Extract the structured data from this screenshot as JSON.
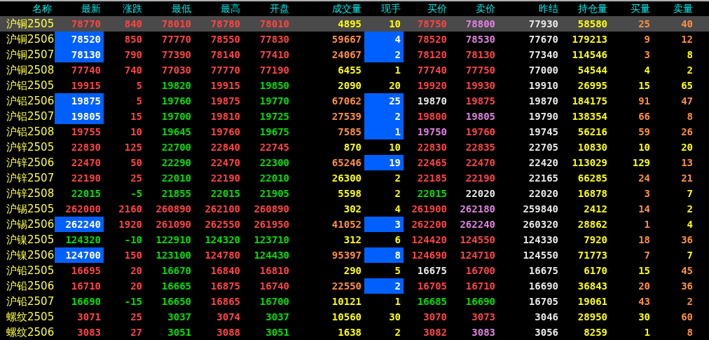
{
  "columns": [
    "名称",
    "最新",
    "涨跌",
    "最低",
    "最高",
    "开盘",
    "成交量",
    "现手",
    "买价",
    "卖价",
    "昨结",
    "持仓量",
    "买量",
    "卖量"
  ],
  "rows": [
    {
      "name": "沪铜2505",
      "selected": true,
      "last_flash": false,
      "hand_flash": false,
      "cells": [
        {
          "t": "78770",
          "color": "#ff4444"
        },
        {
          "t": "840",
          "color": "#ff4444"
        },
        {
          "t": "78010",
          "color": "#ff4444"
        },
        {
          "t": "78780",
          "color": "#ff4444"
        },
        {
          "t": "78010",
          "color": "#ff4444"
        },
        {
          "t": "4895",
          "color": "#ffff00"
        },
        {
          "t": "10",
          "color": "#ffff00"
        },
        {
          "t": "78750",
          "color": "#ff4444"
        },
        {
          "t": "78800",
          "color": "#e080e0"
        },
        {
          "t": "77930",
          "color": "#e8e8e8"
        },
        {
          "t": "58580",
          "color": "#ffff00"
        },
        {
          "t": "25",
          "color": "#ff9040"
        },
        {
          "t": "40",
          "color": "#ff9040"
        }
      ]
    },
    {
      "name": "沪铜2506",
      "selected": false,
      "last_flash": true,
      "hand_flash": true,
      "cells": [
        {
          "t": "78520",
          "color": "#ffffff"
        },
        {
          "t": "850",
          "color": "#ff4444"
        },
        {
          "t": "77770",
          "color": "#ff4444"
        },
        {
          "t": "78550",
          "color": "#ff4444"
        },
        {
          "t": "77830",
          "color": "#ff4444"
        },
        {
          "t": "59667",
          "color": "#ff9040"
        },
        {
          "t": "4",
          "color": "#ffffff"
        },
        {
          "t": "78520",
          "color": "#ff4444"
        },
        {
          "t": "78530",
          "color": "#e080e0"
        },
        {
          "t": "77670",
          "color": "#e8e8e8"
        },
        {
          "t": "179213",
          "color": "#ffff00"
        },
        {
          "t": "9",
          "color": "#ff9040"
        },
        {
          "t": "12",
          "color": "#ff9040"
        }
      ]
    },
    {
      "name": "沪铜2507",
      "selected": false,
      "last_flash": true,
      "hand_flash": true,
      "cells": [
        {
          "t": "78130",
          "color": "#ffffff"
        },
        {
          "t": "790",
          "color": "#ff4444"
        },
        {
          "t": "77390",
          "color": "#ff4444"
        },
        {
          "t": "78140",
          "color": "#ff4444"
        },
        {
          "t": "77410",
          "color": "#ff4444"
        },
        {
          "t": "24067",
          "color": "#ff9040"
        },
        {
          "t": "2",
          "color": "#ffffff"
        },
        {
          "t": "78120",
          "color": "#ff4444"
        },
        {
          "t": "78130",
          "color": "#ff4444"
        },
        {
          "t": "77340",
          "color": "#e8e8e8"
        },
        {
          "t": "114546",
          "color": "#ffff00"
        },
        {
          "t": "3",
          "color": "#ff9040"
        },
        {
          "t": "8",
          "color": "#ffff00"
        }
      ]
    },
    {
      "name": "沪铜2508",
      "selected": false,
      "last_flash": false,
      "hand_flash": false,
      "cells": [
        {
          "t": "77740",
          "color": "#ff4444"
        },
        {
          "t": "740",
          "color": "#ff4444"
        },
        {
          "t": "77030",
          "color": "#ff4444"
        },
        {
          "t": "77770",
          "color": "#ff4444"
        },
        {
          "t": "77190",
          "color": "#ff4444"
        },
        {
          "t": "6455",
          "color": "#ffff00"
        },
        {
          "t": "1",
          "color": "#ffff00"
        },
        {
          "t": "77740",
          "color": "#ff4444"
        },
        {
          "t": "77750",
          "color": "#ff4444"
        },
        {
          "t": "77000",
          "color": "#e8e8e8"
        },
        {
          "t": "54544",
          "color": "#ffff00"
        },
        {
          "t": "4",
          "color": "#ffff00"
        },
        {
          "t": "2",
          "color": "#ffff00"
        }
      ]
    },
    {
      "name": "沪铝2505",
      "selected": false,
      "last_flash": false,
      "hand_flash": false,
      "cells": [
        {
          "t": "19915",
          "color": "#ff4444"
        },
        {
          "t": "5",
          "color": "#ff4444"
        },
        {
          "t": "19820",
          "color": "#00e000"
        },
        {
          "t": "19915",
          "color": "#ff4444"
        },
        {
          "t": "19850",
          "color": "#00e000"
        },
        {
          "t": "2090",
          "color": "#ffff00"
        },
        {
          "t": "20",
          "color": "#ffff00"
        },
        {
          "t": "19920",
          "color": "#ff4444"
        },
        {
          "t": "19930",
          "color": "#ff4444"
        },
        {
          "t": "19910",
          "color": "#e8e8e8"
        },
        {
          "t": "26995",
          "color": "#ffff00"
        },
        {
          "t": "15",
          "color": "#ffff00"
        },
        {
          "t": "65",
          "color": "#ffff00"
        }
      ]
    },
    {
      "name": "沪铝2506",
      "selected": false,
      "last_flash": true,
      "hand_flash": true,
      "cells": [
        {
          "t": "19875",
          "color": "#ffffff"
        },
        {
          "t": "5",
          "color": "#ff4444"
        },
        {
          "t": "19760",
          "color": "#00e000"
        },
        {
          "t": "19875",
          "color": "#ff4444"
        },
        {
          "t": "19770",
          "color": "#00e000"
        },
        {
          "t": "67062",
          "color": "#ff9040"
        },
        {
          "t": "25",
          "color": "#ffffff"
        },
        {
          "t": "19870",
          "color": "#e8e8e8"
        },
        {
          "t": "19875",
          "color": "#ff4444"
        },
        {
          "t": "19870",
          "color": "#e8e8e8"
        },
        {
          "t": "184175",
          "color": "#ffff00"
        },
        {
          "t": "91",
          "color": "#ff9040"
        },
        {
          "t": "47",
          "color": "#ff9040"
        }
      ]
    },
    {
      "name": "沪铝2507",
      "selected": false,
      "last_flash": true,
      "hand_flash": true,
      "cells": [
        {
          "t": "19805",
          "color": "#ffffff"
        },
        {
          "t": "15",
          "color": "#ff4444"
        },
        {
          "t": "19700",
          "color": "#00e000"
        },
        {
          "t": "19810",
          "color": "#ff4444"
        },
        {
          "t": "19725",
          "color": "#00e000"
        },
        {
          "t": "27539",
          "color": "#ff9040"
        },
        {
          "t": "2",
          "color": "#ffffff"
        },
        {
          "t": "19800",
          "color": "#ff4444"
        },
        {
          "t": "19805",
          "color": "#e080e0"
        },
        {
          "t": "19790",
          "color": "#e8e8e8"
        },
        {
          "t": "138354",
          "color": "#ffff00"
        },
        {
          "t": "66",
          "color": "#ff9040"
        },
        {
          "t": "8",
          "color": "#ff9040"
        }
      ]
    },
    {
      "name": "沪铝2508",
      "selected": false,
      "last_flash": false,
      "hand_flash": true,
      "cells": [
        {
          "t": "19755",
          "color": "#ff4444"
        },
        {
          "t": "10",
          "color": "#ff4444"
        },
        {
          "t": "19645",
          "color": "#00e000"
        },
        {
          "t": "19760",
          "color": "#ff4444"
        },
        {
          "t": "19675",
          "color": "#00e000"
        },
        {
          "t": "7585",
          "color": "#ff9040"
        },
        {
          "t": "1",
          "color": "#ffffff"
        },
        {
          "t": "19750",
          "color": "#e080e0"
        },
        {
          "t": "19760",
          "color": "#ff4444"
        },
        {
          "t": "19745",
          "color": "#e8e8e8"
        },
        {
          "t": "56216",
          "color": "#ffff00"
        },
        {
          "t": "59",
          "color": "#ff9040"
        },
        {
          "t": "26",
          "color": "#ff9040"
        }
      ]
    },
    {
      "name": "沪锌2505",
      "selected": false,
      "last_flash": false,
      "hand_flash": false,
      "cells": [
        {
          "t": "22830",
          "color": "#ff4444"
        },
        {
          "t": "125",
          "color": "#ff4444"
        },
        {
          "t": "22700",
          "color": "#00e000"
        },
        {
          "t": "22840",
          "color": "#ff4444"
        },
        {
          "t": "22745",
          "color": "#ff4444"
        },
        {
          "t": "870",
          "color": "#ffff00"
        },
        {
          "t": "10",
          "color": "#ffff00"
        },
        {
          "t": "22830",
          "color": "#ff4444"
        },
        {
          "t": "22835",
          "color": "#ff4444"
        },
        {
          "t": "22705",
          "color": "#e8e8e8"
        },
        {
          "t": "10830",
          "color": "#ffff00"
        },
        {
          "t": "10",
          "color": "#ffff00"
        },
        {
          "t": "20",
          "color": "#ffff00"
        }
      ]
    },
    {
      "name": "沪锌2506",
      "selected": false,
      "last_flash": false,
      "hand_flash": true,
      "cells": [
        {
          "t": "22470",
          "color": "#ff4444"
        },
        {
          "t": "50",
          "color": "#ff4444"
        },
        {
          "t": "22290",
          "color": "#00e000"
        },
        {
          "t": "22470",
          "color": "#ff4444"
        },
        {
          "t": "22300",
          "color": "#00e000"
        },
        {
          "t": "65246",
          "color": "#ff9040"
        },
        {
          "t": "19",
          "color": "#ffffff"
        },
        {
          "t": "22465",
          "color": "#ff4444"
        },
        {
          "t": "22470",
          "color": "#ff4444"
        },
        {
          "t": "22420",
          "color": "#e8e8e8"
        },
        {
          "t": "113029",
          "color": "#ffff00"
        },
        {
          "t": "129",
          "color": "#ffff00"
        },
        {
          "t": "13",
          "color": "#ff9040"
        }
      ]
    },
    {
      "name": "沪锌2507",
      "selected": false,
      "last_flash": false,
      "hand_flash": false,
      "cells": [
        {
          "t": "22190",
          "color": "#ff4444"
        },
        {
          "t": "25",
          "color": "#ff4444"
        },
        {
          "t": "22010",
          "color": "#00e000"
        },
        {
          "t": "22190",
          "color": "#ff4444"
        },
        {
          "t": "22010",
          "color": "#00e000"
        },
        {
          "t": "26300",
          "color": "#ffff00"
        },
        {
          "t": "2",
          "color": "#ffff00"
        },
        {
          "t": "22185",
          "color": "#ff4444"
        },
        {
          "t": "22190",
          "color": "#ff4444"
        },
        {
          "t": "22165",
          "color": "#e8e8e8"
        },
        {
          "t": "66285",
          "color": "#ffff00"
        },
        {
          "t": "24",
          "color": "#ff9040"
        },
        {
          "t": "21",
          "color": "#ff9040"
        }
      ]
    },
    {
      "name": "沪锌2508",
      "selected": false,
      "last_flash": false,
      "hand_flash": false,
      "cells": [
        {
          "t": "22015",
          "color": "#00e000"
        },
        {
          "t": "-5",
          "color": "#00e000"
        },
        {
          "t": "21855",
          "color": "#00e000"
        },
        {
          "t": "22015",
          "color": "#00e000"
        },
        {
          "t": "21905",
          "color": "#00e000"
        },
        {
          "t": "5598",
          "color": "#ffff00"
        },
        {
          "t": "2",
          "color": "#ffff00"
        },
        {
          "t": "22015",
          "color": "#00e000"
        },
        {
          "t": "22020",
          "color": "#e8e8e8"
        },
        {
          "t": "22020",
          "color": "#e8e8e8"
        },
        {
          "t": "16878",
          "color": "#ffff00"
        },
        {
          "t": "3",
          "color": "#ff9040"
        },
        {
          "t": "7",
          "color": "#ffff00"
        }
      ]
    },
    {
      "name": "沪锡2505",
      "selected": false,
      "last_flash": false,
      "hand_flash": false,
      "cells": [
        {
          "t": "262000",
          "color": "#ff4444"
        },
        {
          "t": "2160",
          "color": "#ff4444"
        },
        {
          "t": "260890",
          "color": "#ff4444"
        },
        {
          "t": "262100",
          "color": "#ff4444"
        },
        {
          "t": "260890",
          "color": "#ff4444"
        },
        {
          "t": "302",
          "color": "#ffff00"
        },
        {
          "t": "4",
          "color": "#ffff00"
        },
        {
          "t": "261900",
          "color": "#ff4444"
        },
        {
          "t": "262180",
          "color": "#e080e0"
        },
        {
          "t": "259840",
          "color": "#e8e8e8"
        },
        {
          "t": "2412",
          "color": "#ffff00"
        },
        {
          "t": "14",
          "color": "#ff9040"
        },
        {
          "t": "2",
          "color": "#ffff00"
        }
      ]
    },
    {
      "name": "沪锡2506",
      "selected": false,
      "last_flash": true,
      "hand_flash": true,
      "cells": [
        {
          "t": "262240",
          "color": "#ffffff"
        },
        {
          "t": "1920",
          "color": "#ff4444"
        },
        {
          "t": "261090",
          "color": "#ff4444"
        },
        {
          "t": "262550",
          "color": "#ff4444"
        },
        {
          "t": "261950",
          "color": "#ff4444"
        },
        {
          "t": "41052",
          "color": "#ff9040"
        },
        {
          "t": "3",
          "color": "#ffffff"
        },
        {
          "t": "262200",
          "color": "#ff4444"
        },
        {
          "t": "262240",
          "color": "#e080e0"
        },
        {
          "t": "260320",
          "color": "#e8e8e8"
        },
        {
          "t": "28862",
          "color": "#ffff00"
        },
        {
          "t": "1",
          "color": "#ff9040"
        },
        {
          "t": "4",
          "color": "#ffff00"
        }
      ]
    },
    {
      "name": "沪镍2505",
      "selected": false,
      "last_flash": false,
      "hand_flash": false,
      "cells": [
        {
          "t": "124320",
          "color": "#00e000"
        },
        {
          "t": "-10",
          "color": "#00e000"
        },
        {
          "t": "122910",
          "color": "#00e000"
        },
        {
          "t": "124320",
          "color": "#00e000"
        },
        {
          "t": "123710",
          "color": "#00e000"
        },
        {
          "t": "312",
          "color": "#ffff00"
        },
        {
          "t": "6",
          "color": "#ffff00"
        },
        {
          "t": "124420",
          "color": "#ff4444"
        },
        {
          "t": "124550",
          "color": "#ff4444"
        },
        {
          "t": "124330",
          "color": "#e8e8e8"
        },
        {
          "t": "7920",
          "color": "#ffff00"
        },
        {
          "t": "18",
          "color": "#ff9040"
        },
        {
          "t": "36",
          "color": "#ff9040"
        }
      ]
    },
    {
      "name": "沪镍2506",
      "selected": false,
      "last_flash": true,
      "hand_flash": true,
      "cells": [
        {
          "t": "124700",
          "color": "#ffffff"
        },
        {
          "t": "150",
          "color": "#ff4444"
        },
        {
          "t": "123100",
          "color": "#00e000"
        },
        {
          "t": "124780",
          "color": "#ff4444"
        },
        {
          "t": "124430",
          "color": "#00e000"
        },
        {
          "t": "95397",
          "color": "#ff9040"
        },
        {
          "t": "8",
          "color": "#ffffff"
        },
        {
          "t": "124690",
          "color": "#ff4444"
        },
        {
          "t": "124710",
          "color": "#ff4444"
        },
        {
          "t": "124550",
          "color": "#e8e8e8"
        },
        {
          "t": "71773",
          "color": "#ffff00"
        },
        {
          "t": "7",
          "color": "#ff9040"
        },
        {
          "t": "7",
          "color": "#ffff00"
        }
      ]
    },
    {
      "name": "沪铅2505",
      "selected": false,
      "last_flash": false,
      "hand_flash": false,
      "cells": [
        {
          "t": "16695",
          "color": "#ff4444"
        },
        {
          "t": "20",
          "color": "#ff4444"
        },
        {
          "t": "16670",
          "color": "#00e000"
        },
        {
          "t": "16840",
          "color": "#ff4444"
        },
        {
          "t": "16810",
          "color": "#ff4444"
        },
        {
          "t": "290",
          "color": "#ffff00"
        },
        {
          "t": "5",
          "color": "#ffff00"
        },
        {
          "t": "16675",
          "color": "#e8e8e8"
        },
        {
          "t": "16700",
          "color": "#ff4444"
        },
        {
          "t": "16675",
          "color": "#e8e8e8"
        },
        {
          "t": "6170",
          "color": "#ffff00"
        },
        {
          "t": "15",
          "color": "#ffff00"
        },
        {
          "t": "45",
          "color": "#ff9040"
        }
      ]
    },
    {
      "name": "沪铅2506",
      "selected": false,
      "last_flash": false,
      "hand_flash": true,
      "cells": [
        {
          "t": "16710",
          "color": "#ff4444"
        },
        {
          "t": "20",
          "color": "#ff4444"
        },
        {
          "t": "16665",
          "color": "#00e000"
        },
        {
          "t": "16875",
          "color": "#ff4444"
        },
        {
          "t": "16740",
          "color": "#ff4444"
        },
        {
          "t": "22550",
          "color": "#ff9040"
        },
        {
          "t": "2",
          "color": "#ffffff"
        },
        {
          "t": "16705",
          "color": "#ff4444"
        },
        {
          "t": "16710",
          "color": "#ff4444"
        },
        {
          "t": "16690",
          "color": "#e8e8e8"
        },
        {
          "t": "36843",
          "color": "#ffff00"
        },
        {
          "t": "20",
          "color": "#ff9040"
        },
        {
          "t": "36",
          "color": "#ff9040"
        }
      ]
    },
    {
      "name": "沪铅2507",
      "selected": false,
      "last_flash": false,
      "hand_flash": false,
      "cells": [
        {
          "t": "16690",
          "color": "#00e000"
        },
        {
          "t": "-15",
          "color": "#00e000"
        },
        {
          "t": "16650",
          "color": "#00e000"
        },
        {
          "t": "16865",
          "color": "#ff4444"
        },
        {
          "t": "16700",
          "color": "#00e000"
        },
        {
          "t": "10121",
          "color": "#ffff00"
        },
        {
          "t": "1",
          "color": "#ffff00"
        },
        {
          "t": "16685",
          "color": "#00e000"
        },
        {
          "t": "16690",
          "color": "#00e000"
        },
        {
          "t": "16705",
          "color": "#e8e8e8"
        },
        {
          "t": "19061",
          "color": "#ffff00"
        },
        {
          "t": "43",
          "color": "#ff9040"
        },
        {
          "t": "2",
          "color": "#ff9040"
        }
      ]
    },
    {
      "name": "螺纹2505",
      "selected": false,
      "last_flash": false,
      "hand_flash": false,
      "cells": [
        {
          "t": "3071",
          "color": "#ff4444"
        },
        {
          "t": "25",
          "color": "#ff4444"
        },
        {
          "t": "3037",
          "color": "#00e000"
        },
        {
          "t": "3074",
          "color": "#ff4444"
        },
        {
          "t": "3037",
          "color": "#00e000"
        },
        {
          "t": "10560",
          "color": "#ffff00"
        },
        {
          "t": "30",
          "color": "#ffff00"
        },
        {
          "t": "3070",
          "color": "#ff4444"
        },
        {
          "t": "3073",
          "color": "#ff4444"
        },
        {
          "t": "3046",
          "color": "#e8e8e8"
        },
        {
          "t": "28950",
          "color": "#ffff00"
        },
        {
          "t": "30",
          "color": "#ffff00"
        },
        {
          "t": "60",
          "color": "#ff9040"
        }
      ]
    },
    {
      "name": "螺纹2506",
      "selected": false,
      "last_flash": false,
      "hand_flash": false,
      "cells": [
        {
          "t": "3083",
          "color": "#ff4444"
        },
        {
          "t": "27",
          "color": "#ff4444"
        },
        {
          "t": "3051",
          "color": "#00e000"
        },
        {
          "t": "3088",
          "color": "#ff4444"
        },
        {
          "t": "3051",
          "color": "#00e000"
        },
        {
          "t": "1638",
          "color": "#ffff00"
        },
        {
          "t": "2",
          "color": "#ffff00"
        },
        {
          "t": "3082",
          "color": "#ff4444"
        },
        {
          "t": "3083",
          "color": "#e080e0"
        },
        {
          "t": "3056",
          "color": "#e8e8e8"
        },
        {
          "t": "8259",
          "color": "#ffff00"
        },
        {
          "t": "1",
          "color": "#ffff00"
        },
        {
          "t": "8",
          "color": "#ff9040"
        }
      ]
    }
  ]
}
